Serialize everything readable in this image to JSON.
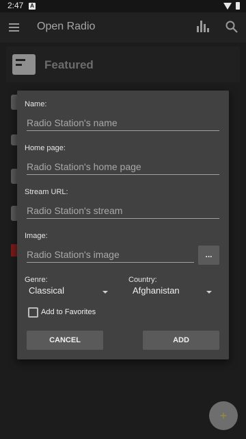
{
  "status_bar": {
    "time": "2:47",
    "notification_icon": "A"
  },
  "app_bar": {
    "title": "Open Radio",
    "menu_icon": "menu-icon",
    "equalizer_icon": "equalizer-icon",
    "search_icon": "search-icon"
  },
  "featured": {
    "label": "Featured",
    "icon": "featured-icon"
  },
  "dialog": {
    "name_label": "Name:",
    "name_placeholder": "Radio Station's name",
    "home_label": "Home page:",
    "home_placeholder": "Radio Station's home page",
    "stream_label": "Stream URL:",
    "stream_placeholder": "Radio Station's stream",
    "image_label": "Image:",
    "image_placeholder": "Radio Station's image",
    "browse_label": "...",
    "genre_label": "Genre:",
    "genre_value": "Classical",
    "country_label": "Country:",
    "country_value": "Afghanistan",
    "favorites_label": "Add to Favorites",
    "favorites_checked": false,
    "cancel_label": "CANCEL",
    "add_label": "ADD"
  },
  "fab": {
    "label": "+"
  }
}
